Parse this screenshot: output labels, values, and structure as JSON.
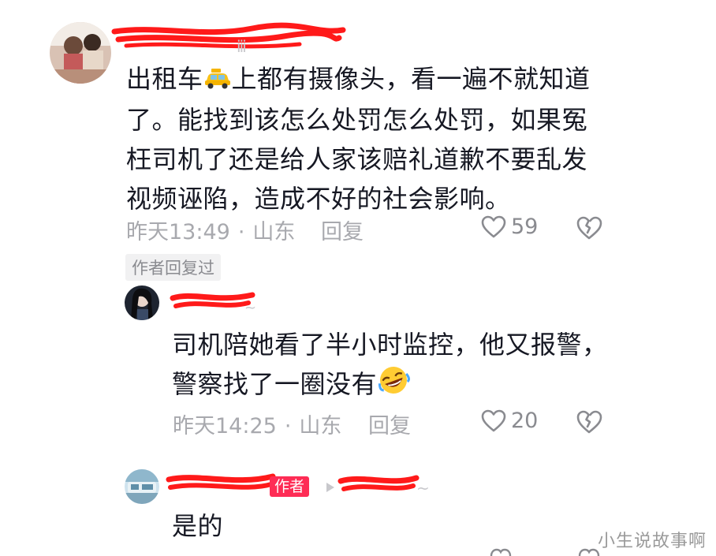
{
  "comment1": {
    "username": "",
    "text_before_emoji": "出租车",
    "emoji": "taxi-emoji",
    "text_line1_rest": "上都有摄像头，看一遍不就知道",
    "text_line2": "了。能找到该怎么处罚怎么处罚，如果冤",
    "text_line3": "枉司机了还是给人家该赔礼道歉不要乱发",
    "text_line4": "视频诬陷，造成不好的社会影响。",
    "time": "昨天13:49",
    "dot": "·",
    "location": "山东",
    "reply_label": "回复",
    "likes": "59",
    "author_replied_badge": "作者回复过"
  },
  "reply1": {
    "username": "",
    "text_line1": "司机陪她看了半小时监控，他又报警，",
    "text_line2": "警察找了一圈没有",
    "emoji": "rolling-laugh-emoji",
    "time": "昨天14:25",
    "dot": "·",
    "location": "山东",
    "reply_label": "回复",
    "likes": "20"
  },
  "reply2": {
    "username": "",
    "author_tag": "作者",
    "reply_to": "",
    "text": "是的"
  },
  "watermark": "小生说故事啊",
  "colors": {
    "text": "#161823",
    "meta": "#a8a9ae",
    "author_tag": "#fe2c55",
    "redaction": "#ff1a1a"
  }
}
